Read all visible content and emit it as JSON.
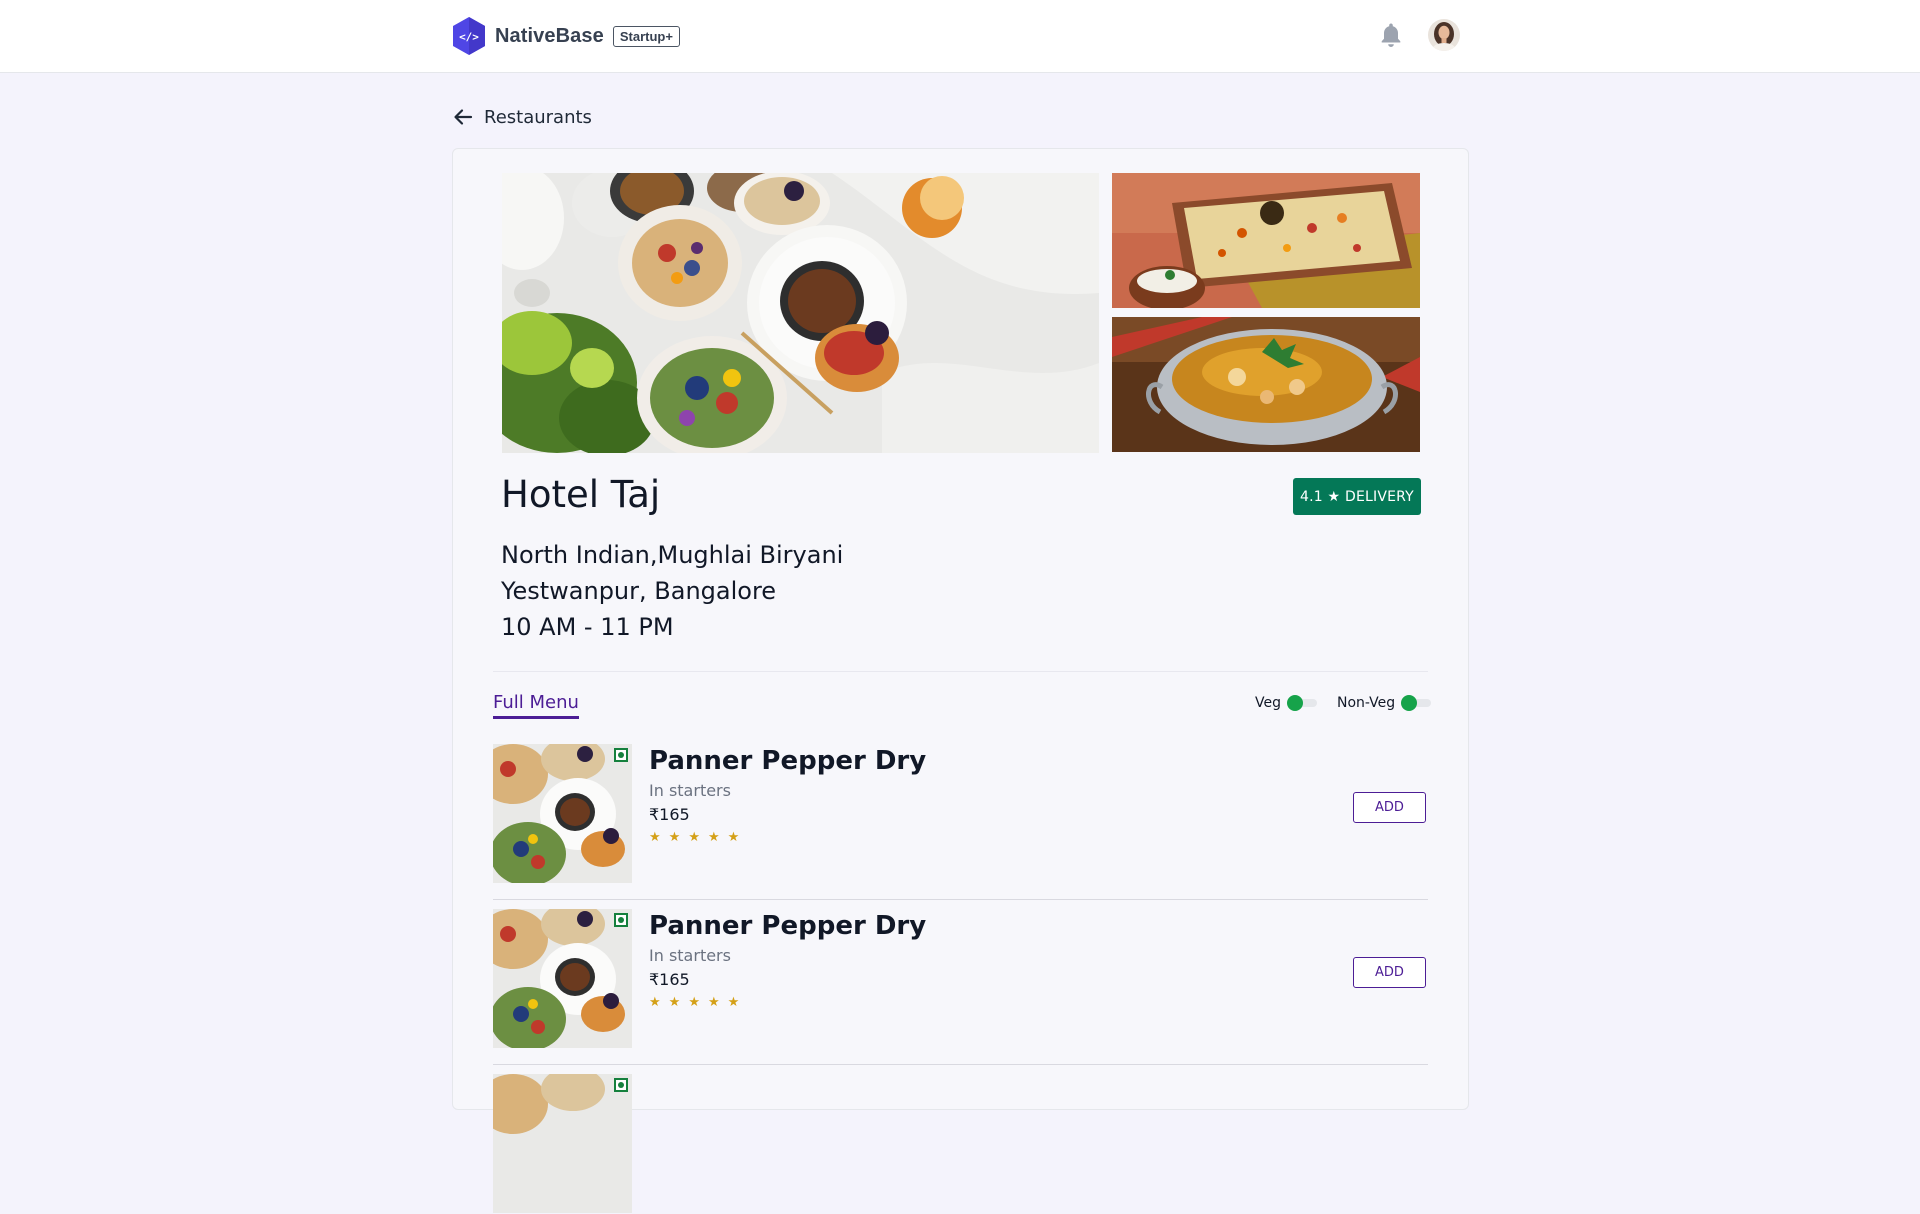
{
  "header": {
    "brand": "NativeBase",
    "plan_badge": "Startup+",
    "logo_glyph": "</>"
  },
  "nav": {
    "back_label": "Restaurants"
  },
  "restaurant": {
    "name": "Hotel Taj",
    "rating_badge": "4.1 ★ DELIVERY",
    "cuisine": "North Indian,Mughlai Biryani",
    "location": "Yestwanpur, Bangalore",
    "hours": "10 AM - 11 PM"
  },
  "menu": {
    "tab_label": "Full Menu",
    "filters": [
      {
        "label": "Veg",
        "on": true
      },
      {
        "label": "Non-Veg",
        "on": true
      }
    ],
    "items": [
      {
        "name": "Panner Pepper Dry",
        "category": "In starters",
        "price": "₹165",
        "rating": 5,
        "button": "ADD"
      },
      {
        "name": "Panner Pepper Dry",
        "category": "In starters",
        "price": "₹165",
        "rating": 5,
        "button": "ADD"
      }
    ]
  },
  "colors": {
    "brand": "#4f46e5",
    "accent": "#4c1d95",
    "rating_bg": "#047857",
    "veg": "#16a34a",
    "star": "#d4a017"
  },
  "icons": [
    "nativebase-logo-icon",
    "bell-icon",
    "arrow-left-icon",
    "veg-indicator-icon",
    "star-icon"
  ]
}
